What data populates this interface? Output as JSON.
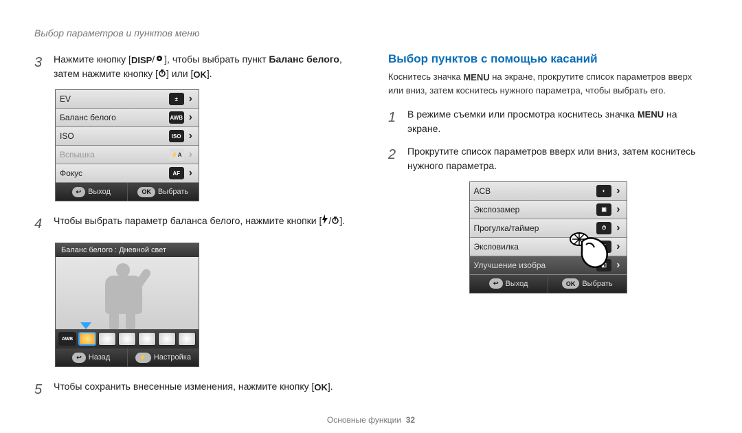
{
  "header": {
    "title": "Выбор параметров и пунктов меню"
  },
  "footer": {
    "label": "Основные функции",
    "page": "32"
  },
  "left": {
    "step3": {
      "num": "3",
      "text_a": "Нажмите кнопку [",
      "disp": "DISP",
      "text_b": "], чтобы выбрать пункт ",
      "bold": "Баланс белого",
      "text_c": ", затем нажмите кнопку [",
      "text_d": "] или [",
      "ok": "OK",
      "text_e": "]."
    },
    "menu": {
      "items": [
        {
          "label": "EV",
          "icon": "±",
          "chev": "›"
        },
        {
          "label": "Баланс белого",
          "icon": "AWB",
          "chev": "›"
        },
        {
          "label": "ISO",
          "icon": "ISO",
          "chev": "›"
        },
        {
          "label": "Вспышка",
          "icon": "⚡A",
          "chev": "›",
          "disabled": true
        },
        {
          "label": "Фокус",
          "icon": "AF",
          "chev": "›"
        }
      ],
      "bottom": {
        "left_icon": "↩",
        "left": "Выход",
        "right_icon": "OK",
        "right": "Выбрать"
      }
    },
    "step4": {
      "num": "4",
      "text_a": "Чтобы выбрать параметр баланса белого, нажмите кнопки [",
      "text_b": "]."
    },
    "lcd": {
      "caption": "Баланс белого : Дневной свет",
      "awb_label": "AWB",
      "bottom": {
        "left_icon": "↩",
        "left": "Назад",
        "right_icon": "⚡",
        "right": "Настройка"
      }
    },
    "step5": {
      "num": "5",
      "text_a": "Чтобы сохранить внесенные изменения, нажмите кнопку [",
      "ok": "OK",
      "text_b": "]."
    }
  },
  "right": {
    "heading": "Выбор пунктов с помощью касаний",
    "intro_a": "Коснитесь значка ",
    "menu_word": "MENU",
    "intro_b": " на экране, прокрутите список параметров вверх или вниз, затем коснитесь нужного параметра, чтобы выбрать его.",
    "step1": {
      "num": "1",
      "text_a": "В режиме съемки или просмотра коснитесь значка ",
      "menu_word": "MENU",
      "text_b": " на экране."
    },
    "step2": {
      "num": "2",
      "text": "Прокрутите список параметров вверх или вниз, затем коснитесь нужного параметра."
    },
    "menu": {
      "items": [
        {
          "label": "ACB",
          "icon": "◐",
          "chev": "›"
        },
        {
          "label": "Экспозамер",
          "icon": "▣",
          "chev": "›"
        },
        {
          "label": "Прогулка/таймер",
          "icon": "⏱",
          "chev": "›"
        },
        {
          "label": "Эксповилка",
          "icon": "E",
          "chev": "›"
        },
        {
          "label": "Улучшение изобра",
          "icon": "◧",
          "chev": "›",
          "dark": true
        }
      ],
      "bottom": {
        "left_icon": "↩",
        "left": "Выход",
        "right_icon": "OK",
        "right": "Выбрать"
      }
    }
  }
}
